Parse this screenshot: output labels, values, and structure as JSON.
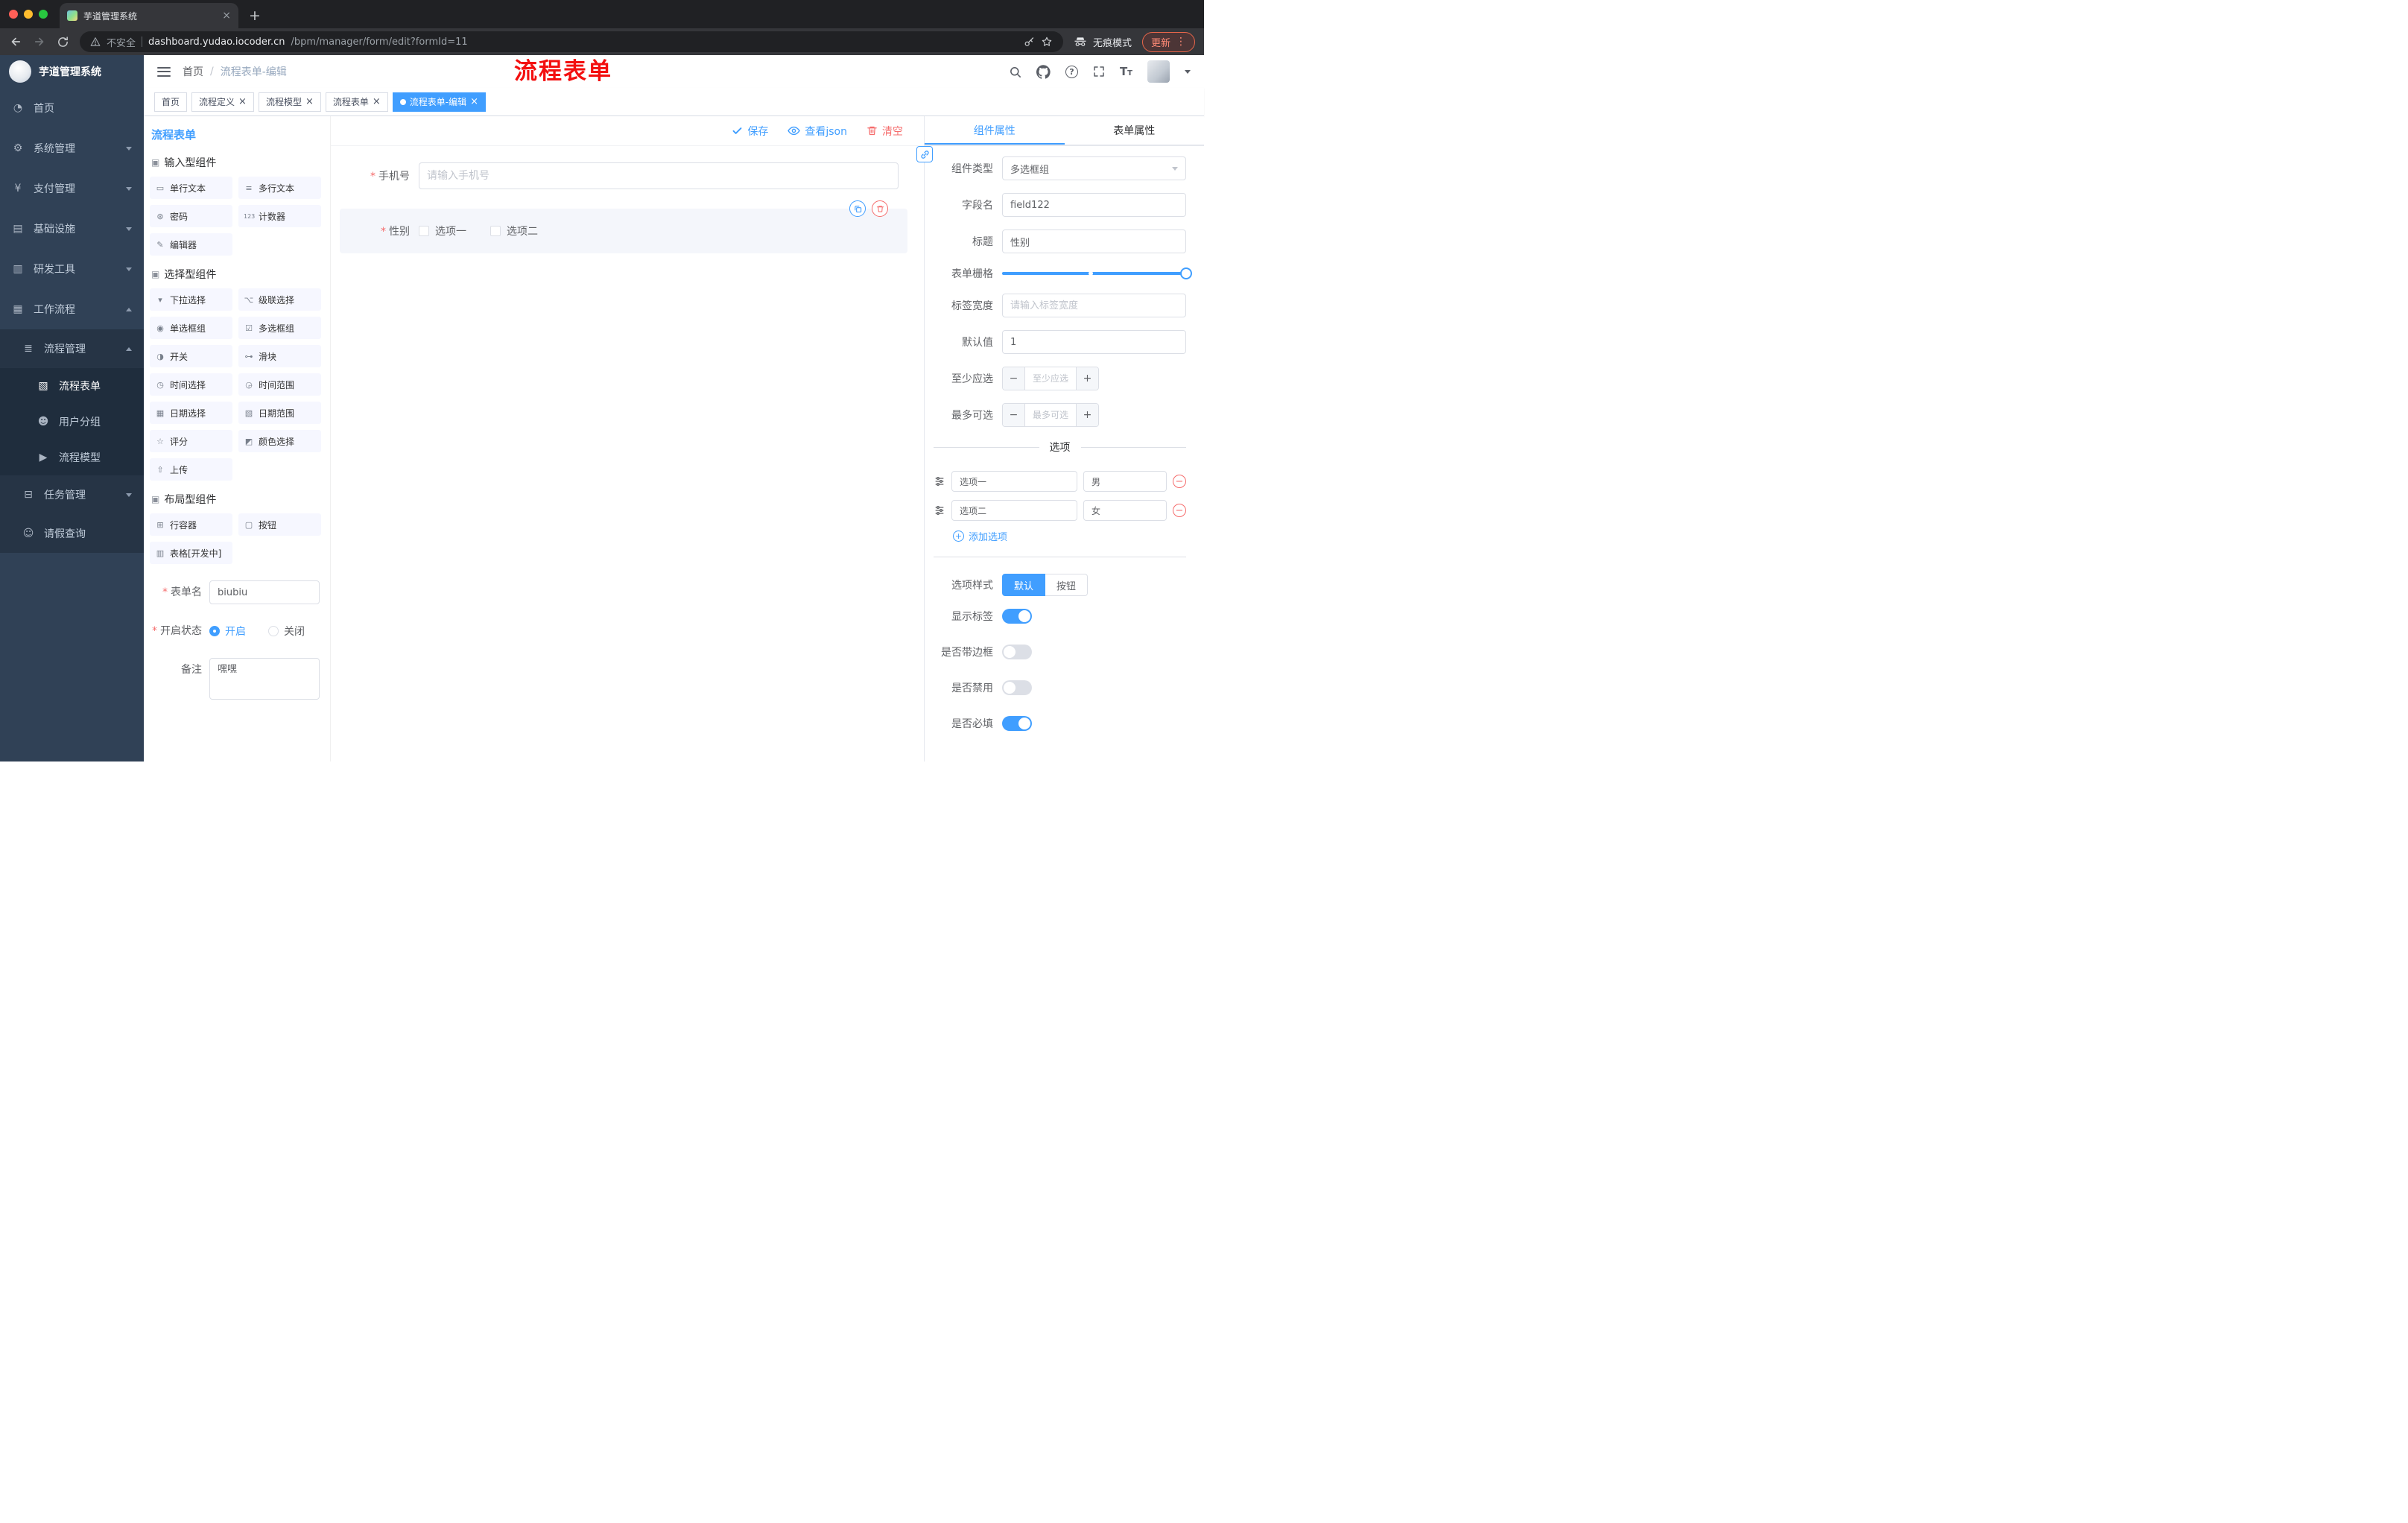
{
  "browser": {
    "tab_title": "芋道管理系统",
    "security_label": "不安全",
    "url_domain": "dashboard.yudao.iocoder.cn",
    "url_path": "/bpm/manager/form/edit?formId=11",
    "incognito_label": "无痕模式",
    "update_label": "更新"
  },
  "sidebar": {
    "logo_title": "芋道管理系统",
    "menu": [
      {
        "label": "首页"
      },
      {
        "label": "系统管理"
      },
      {
        "label": "支付管理"
      },
      {
        "label": "基础设施"
      },
      {
        "label": "研发工具"
      },
      {
        "label": "工作流程"
      }
    ],
    "submenu": {
      "parent": {
        "label": "流程管理"
      },
      "children": [
        {
          "label": "流程表单"
        },
        {
          "label": "用户分组"
        },
        {
          "label": "流程模型"
        }
      ],
      "siblings": [
        {
          "label": "任务管理"
        },
        {
          "label": "请假查询"
        }
      ]
    }
  },
  "header": {
    "breadcrumb": [
      "首页",
      "流程表单-编辑"
    ],
    "annotation": "流程表单"
  },
  "tags": [
    {
      "label": "首页",
      "closable": false,
      "active": false
    },
    {
      "label": "流程定义",
      "closable": true,
      "active": false
    },
    {
      "label": "流程模型",
      "closable": true,
      "active": false
    },
    {
      "label": "流程表单",
      "closable": true,
      "active": false
    },
    {
      "label": "流程表单-编辑",
      "closable": true,
      "active": true
    }
  ],
  "designer": {
    "panel_title": "流程表单",
    "toolbar": {
      "save": "保存",
      "view_json": "查看json",
      "clear": "清空"
    },
    "palette": {
      "groups": [
        {
          "title": "输入型组件",
          "items": [
            "单行文本",
            "多行文本",
            "密码",
            "计数器",
            "编辑器"
          ]
        },
        {
          "title": "选择型组件",
          "items": [
            "下拉选择",
            "级联选择",
            "单选框组",
            "多选框组",
            "开关",
            "滑块",
            "时间选择",
            "时间范围",
            "日期选择",
            "日期范围",
            "评分",
            "颜色选择",
            "上传"
          ]
        },
        {
          "title": "布局型组件",
          "items": [
            "行容器",
            "按钮",
            "表格[开发中]"
          ]
        }
      ]
    },
    "meta": {
      "name_label": "表单名",
      "name_value": "biubiu",
      "status_label": "开启状态",
      "status_on": "开启",
      "status_off": "关闭",
      "remark_label": "备注",
      "remark_value": "嘿嘿"
    },
    "canvas": {
      "phone": {
        "label": "手机号",
        "placeholder": "请输入手机号"
      },
      "gender": {
        "label": "性别",
        "options": [
          "选项一",
          "选项二"
        ]
      }
    }
  },
  "props": {
    "tabs": [
      "组件属性",
      "表单属性"
    ],
    "component_type": {
      "label": "组件类型",
      "value": "多选框组"
    },
    "field_name": {
      "label": "字段名",
      "value": "field122"
    },
    "title": {
      "label": "标题",
      "value": "性别"
    },
    "grid": {
      "label": "表单栅格"
    },
    "label_width": {
      "label": "标签宽度",
      "placeholder": "请输入标签宽度"
    },
    "default_value": {
      "label": "默认值",
      "value": "1"
    },
    "min_select": {
      "label": "至少应选",
      "placeholder": "至少应选"
    },
    "max_select": {
      "label": "最多可选",
      "placeholder": "最多可选"
    },
    "options_title": "选项",
    "options": [
      {
        "name": "选项一",
        "value": "男"
      },
      {
        "name": "选项二",
        "value": "女"
      }
    ],
    "add_option": "添加选项",
    "option_style": {
      "label": "选项样式",
      "choices": [
        "默认",
        "按钮"
      ],
      "selected": "默认"
    },
    "toggles": [
      {
        "label": "显示标签",
        "on": true
      },
      {
        "label": "是否带边框",
        "on": false
      },
      {
        "label": "是否禁用",
        "on": false
      },
      {
        "label": "是否必填",
        "on": true
      }
    ]
  },
  "colors": {
    "accent": "#409eff",
    "danger": "#f56c6c",
    "annotation": "#ff0000",
    "sidebar": "#304156"
  }
}
